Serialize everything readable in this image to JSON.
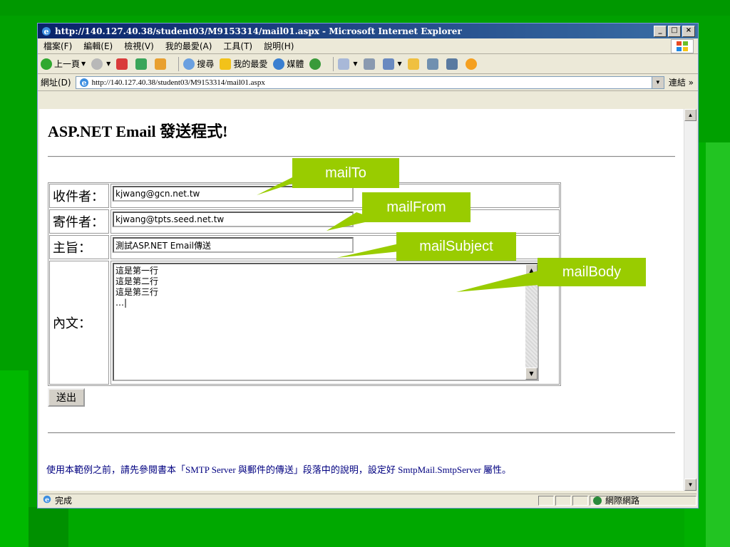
{
  "window": {
    "title": "http://140.127.40.38/student03/M9153314/mail01.aspx - Microsoft Internet Explorer",
    "min": "_",
    "max": "□",
    "close": "×"
  },
  "menubar": {
    "items": [
      "檔案(F)",
      "編輯(E)",
      "檢視(V)",
      "我的最愛(A)",
      "工具(T)",
      "說明(H)"
    ]
  },
  "toolbar": {
    "back": "上一頁",
    "search": "搜尋",
    "favorites": "我的最愛",
    "media": "媒體"
  },
  "address": {
    "label": "網址(D)",
    "url": "http://140.127.40.38/student03/M9153314/mail01.aspx",
    "links": "連結 »"
  },
  "page": {
    "title": "ASP.NET Email 發送程式!",
    "labels": {
      "to": "收件者：",
      "from": "寄件者：",
      "subject": "主旨：",
      "body": "內文："
    },
    "values": {
      "to": "kjwang@gcn.net.tw",
      "from": "kjwang@tpts.seed.net.tw",
      "subject": "測試ASP.NET Email傳送",
      "body_lines": [
        "這是第一行",
        "這是第二行",
        "這是第三行",
        "…|"
      ]
    },
    "submit": "送出",
    "footer": "使用本範例之前，請先參閱書本「SMTP Server 與郵件的傳送」段落中的說明，設定好 SmtpMail.SmtpServer 屬性。"
  },
  "status": {
    "text": "完成",
    "zone": "網際網路"
  },
  "callouts": {
    "mailTo": "mailTo",
    "mailFrom": "mailFrom",
    "mailSubject": "mailSubject",
    "mailBody": "mailBody"
  },
  "colors": {
    "slide_bg": "#00a000",
    "callout": "#99cc00",
    "titlebar": "#0a246a"
  }
}
